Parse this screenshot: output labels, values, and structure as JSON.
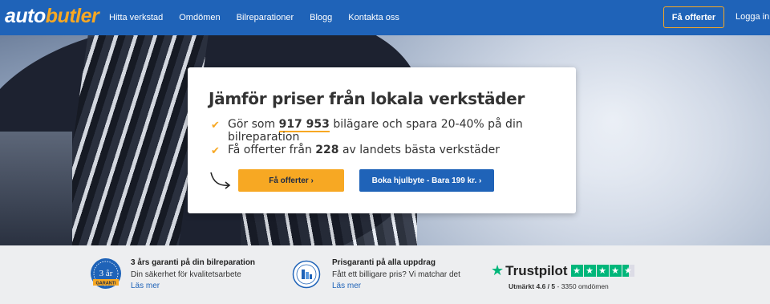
{
  "header": {
    "logo_auto": "auto",
    "logo_butler": "butler",
    "nav": [
      "Hitta verkstad",
      "Omdömen",
      "Bilreparationer",
      "Blogg",
      "Kontakta oss"
    ],
    "cta_label": "Få offerter",
    "login_label": "Logga in"
  },
  "hero": {
    "title": "Jämför priser från lokala verkstäder",
    "line1_pre": "Gör som ",
    "line1_num": "917 953",
    "line1_post": " bilägare och spara 20-40% på din bilreparation",
    "line2_pre": "Få offerter från ",
    "line2_num": "228",
    "line2_post": " av landets bästa verkstäder",
    "btn_primary": "Få offerter ›",
    "btn_secondary": "Boka hjulbyte - Bara 199 kr. ›"
  },
  "features": [
    {
      "title": "3 års garanti på din bilreparation",
      "subtitle": "Din säkerhet för kvalitetsarbete",
      "link": "Läs mer",
      "badge_text": "3 år",
      "badge_label": "GARANTI"
    },
    {
      "title": "Prisgaranti på alla uppdrag",
      "subtitle": "Fått ett billigare pris? Vi matchar det",
      "link": "Läs mer"
    }
  ],
  "trustpilot": {
    "brand": "Trustpilot",
    "rating_label": "Utmärkt",
    "rating": "4.6 / 5",
    "reviews": "3350 omdömen",
    "stars": 4.5
  },
  "colors": {
    "brand_blue": "#1f63b8",
    "accent_orange": "#f7a823",
    "trustpilot_green": "#00b67a"
  }
}
